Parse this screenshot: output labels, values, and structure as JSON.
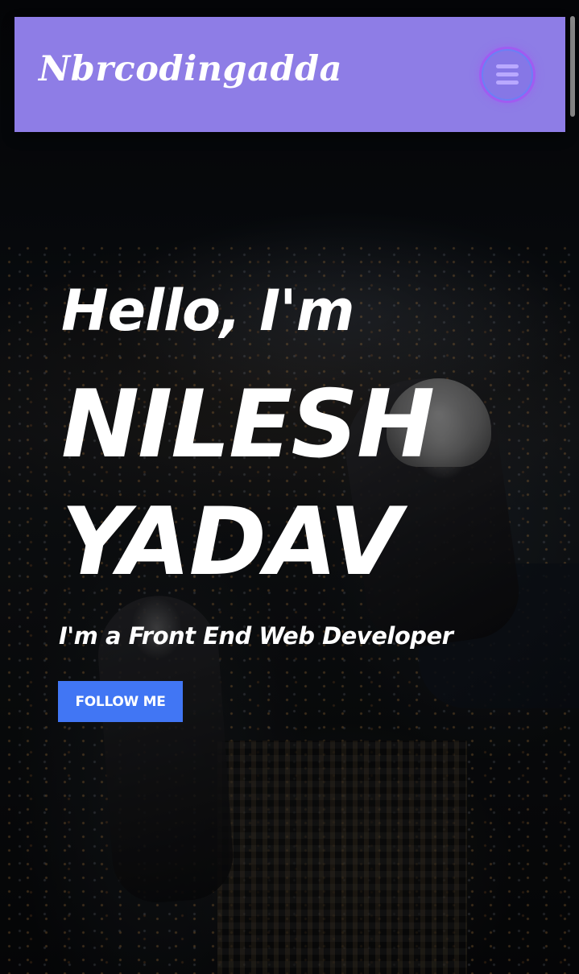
{
  "navbar": {
    "brand": "Nbrcodingadda",
    "menu_icon": "hamburger-menu-icon",
    "background_color": "#8e7de6",
    "menu_ring_color": "#a05cf0"
  },
  "hero": {
    "greeting": "Hello, I'm",
    "name_line1": "NILESH",
    "name_line2": "YADAV",
    "role": "I'm a Front End Web Developer",
    "cta_label": "FOLLOW ME",
    "cta_color": "#4176f4",
    "background_image": "night city skyline with sneakers dangling over a rooftop edge"
  }
}
